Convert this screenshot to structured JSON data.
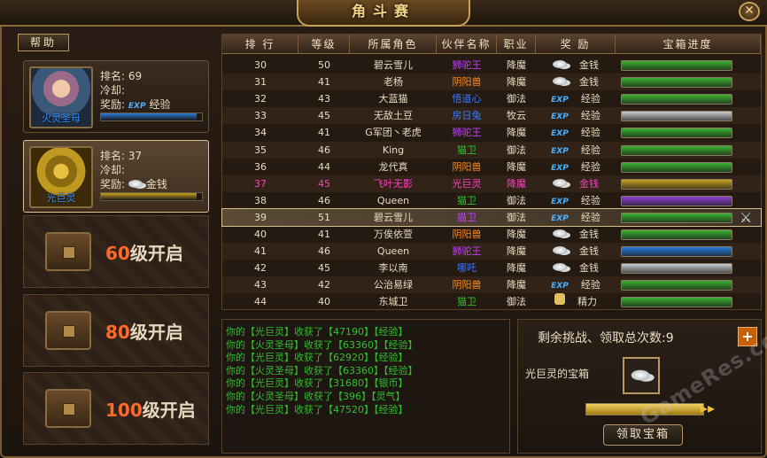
{
  "title": "角斗赛",
  "close_label": "✕",
  "help_label": "帮助",
  "cards": [
    {
      "name": "火灵圣母",
      "rank_label": "排名:",
      "rank": "69",
      "cd_label": "冷却:",
      "cd": "",
      "reward_label": "奖励:",
      "reward_icon": "exp-icon",
      "reward_text": "经验",
      "bar_fill": 0.95,
      "bar_color": "#2a7ad8"
    },
    {
      "name": "光巨灵",
      "rank_label": "排名:",
      "rank": "37",
      "cd_label": "冷却:",
      "cd": "",
      "reward_label": "奖励:",
      "reward_icon": "coin-icon",
      "reward_text": "金钱",
      "bar_fill": 0.95,
      "bar_color": "#c9a020"
    }
  ],
  "locked": [
    {
      "level": "60",
      "text": "级开启"
    },
    {
      "level": "80",
      "text": "级开启"
    },
    {
      "level": "100",
      "text": "级开启"
    }
  ],
  "table": {
    "headers": [
      "排 行",
      "等级",
      "所属角色",
      "伙伴名称",
      "职业",
      "奖 励",
      "宝箱进度"
    ],
    "rows": [
      {
        "rank": "30",
        "level": "50",
        "role": "碧云雪儿",
        "partner": "狮驼王",
        "pcolor": "#c040ff",
        "job": "降魔",
        "reward_icon": "coin-icon",
        "reward": "金钱",
        "progress": 1.0,
        "pcol": "#3ab030"
      },
      {
        "rank": "31",
        "level": "41",
        "role": "老杨",
        "partner": "阴阳兽",
        "pcolor": "#ff8a20",
        "job": "降魔",
        "reward_icon": "coin-icon",
        "reward": "金钱",
        "progress": 1.0,
        "pcol": "#3ab030"
      },
      {
        "rank": "32",
        "level": "43",
        "role": "大蓝猫",
        "partner": "悟道心",
        "pcolor": "#3a7aff",
        "job": "御法",
        "reward_icon": "exp-icon",
        "reward": "经验",
        "progress": 1.0,
        "pcol": "#3ab030"
      },
      {
        "rank": "33",
        "level": "45",
        "role": "无敌土豆",
        "partner": "房日兔",
        "pcolor": "#3a7aff",
        "job": "牧云",
        "reward_icon": "exp-icon",
        "reward": "经验",
        "progress": 1.0,
        "pcol": "#c8ccd0"
      },
      {
        "rank": "34",
        "level": "41",
        "role": "G军团丶老虎",
        "partner": "狮驼王",
        "pcolor": "#c040ff",
        "job": "降魔",
        "reward_icon": "exp-icon",
        "reward": "经验",
        "progress": 1.0,
        "pcol": "#3ab030"
      },
      {
        "rank": "35",
        "level": "46",
        "role": "King",
        "partner": "猫卫",
        "pcolor": "#30c030",
        "job": "御法",
        "reward_icon": "exp-icon",
        "reward": "经验",
        "progress": 1.0,
        "pcol": "#3ab030"
      },
      {
        "rank": "36",
        "level": "44",
        "role": "龙代真",
        "partner": "阴阳兽",
        "pcolor": "#ff8a20",
        "job": "降魔",
        "reward_icon": "exp-icon",
        "reward": "经验",
        "progress": 1.0,
        "pcol": "#3ab030"
      },
      {
        "rank": "37",
        "level": "45",
        "role": "飞叶无影",
        "partner": "光巨灵",
        "pcolor": "#ff40c0",
        "job": "降魔",
        "reward_icon": "coin-icon",
        "reward": "金钱",
        "progress": 1.0,
        "pcol": "#c9a020",
        "me": true
      },
      {
        "rank": "38",
        "level": "46",
        "role": "Queen",
        "partner": "猫卫",
        "pcolor": "#30c030",
        "job": "御法",
        "reward_icon": "exp-icon",
        "reward": "经验",
        "progress": 1.0,
        "pcol": "#8a40d0"
      },
      {
        "rank": "39",
        "level": "51",
        "role": "碧云雪儿",
        "partner": "猫卫",
        "pcolor": "#c040ff",
        "job": "御法",
        "reward_icon": "exp-icon",
        "reward": "经验",
        "progress": 1.0,
        "pcol": "#3ab030",
        "sel": true
      },
      {
        "rank": "40",
        "level": "41",
        "role": "万俟依萱",
        "partner": "阴阳兽",
        "pcolor": "#ff8a20",
        "job": "降魔",
        "reward_icon": "coin-icon",
        "reward": "金钱",
        "progress": 1.0,
        "pcol": "#3ab030"
      },
      {
        "rank": "41",
        "level": "46",
        "role": "Queen",
        "partner": "狮驼王",
        "pcolor": "#c040ff",
        "job": "降魔",
        "reward_icon": "coin-icon",
        "reward": "金钱",
        "progress": 1.0,
        "pcol": "#2a7ad8"
      },
      {
        "rank": "42",
        "level": "45",
        "role": "李以南",
        "partner": "哪吒",
        "pcolor": "#3a7aff",
        "job": "降魔",
        "reward_icon": "coin-icon",
        "reward": "金钱",
        "progress": 1.0,
        "pcol": "#c8ccd0"
      },
      {
        "rank": "43",
        "level": "42",
        "role": "公治易绿",
        "partner": "阴阳兽",
        "pcolor": "#ff8a20",
        "job": "降魔",
        "reward_icon": "exp-icon",
        "reward": "经验",
        "progress": 1.0,
        "pcol": "#3ab030"
      },
      {
        "rank": "44",
        "level": "40",
        "role": "东城卫",
        "partner": "猫卫",
        "pcolor": "#30c030",
        "job": "御法",
        "reward_icon": "fist-icon",
        "reward": "精力",
        "progress": 1.0,
        "pcol": "#3ab030"
      }
    ]
  },
  "log": [
    "你的【光巨灵】收获了【47190】【经验】",
    "你的【火灵圣母】收获了【63360】【经验】",
    "你的【光巨灵】收获了【62920】【经验】",
    "你的【火灵圣母】收获了【63360】【经验】",
    "你的【光巨灵】收获了【31680】【银币】",
    "你的【火灵圣母】收获了【396】【灵气】",
    "你的【光巨灵】收获了【47520】【经验】"
  ],
  "panel": {
    "remain_text": "剩余挑战、领取总次数:9",
    "plus_label": "+",
    "box_label": "光巨灵的宝箱",
    "box_fill": 1.0,
    "arrows": "▸▸",
    "claim_label": "领取宝箱"
  },
  "watermark": "GameRes.com"
}
